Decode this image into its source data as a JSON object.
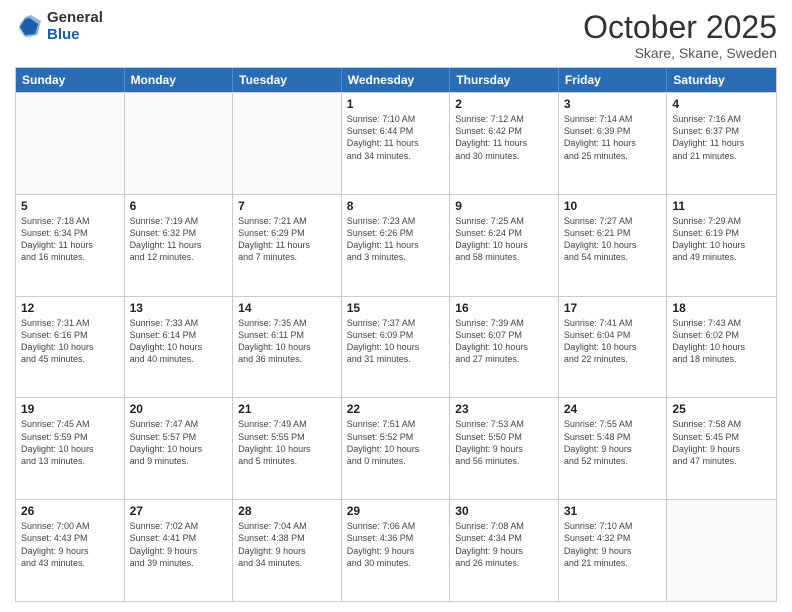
{
  "header": {
    "logo_general": "General",
    "logo_blue": "Blue",
    "month_title": "October 2025",
    "location": "Skare, Skane, Sweden"
  },
  "days_of_week": [
    "Sunday",
    "Monday",
    "Tuesday",
    "Wednesday",
    "Thursday",
    "Friday",
    "Saturday"
  ],
  "weeks": [
    [
      {
        "day": "",
        "text": ""
      },
      {
        "day": "",
        "text": ""
      },
      {
        "day": "",
        "text": ""
      },
      {
        "day": "1",
        "text": "Sunrise: 7:10 AM\nSunset: 6:44 PM\nDaylight: 11 hours\nand 34 minutes."
      },
      {
        "day": "2",
        "text": "Sunrise: 7:12 AM\nSunset: 6:42 PM\nDaylight: 11 hours\nand 30 minutes."
      },
      {
        "day": "3",
        "text": "Sunrise: 7:14 AM\nSunset: 6:39 PM\nDaylight: 11 hours\nand 25 minutes."
      },
      {
        "day": "4",
        "text": "Sunrise: 7:16 AM\nSunset: 6:37 PM\nDaylight: 11 hours\nand 21 minutes."
      }
    ],
    [
      {
        "day": "5",
        "text": "Sunrise: 7:18 AM\nSunset: 6:34 PM\nDaylight: 11 hours\nand 16 minutes."
      },
      {
        "day": "6",
        "text": "Sunrise: 7:19 AM\nSunset: 6:32 PM\nDaylight: 11 hours\nand 12 minutes."
      },
      {
        "day": "7",
        "text": "Sunrise: 7:21 AM\nSunset: 6:29 PM\nDaylight: 11 hours\nand 7 minutes."
      },
      {
        "day": "8",
        "text": "Sunrise: 7:23 AM\nSunset: 6:26 PM\nDaylight: 11 hours\nand 3 minutes."
      },
      {
        "day": "9",
        "text": "Sunrise: 7:25 AM\nSunset: 6:24 PM\nDaylight: 10 hours\nand 58 minutes."
      },
      {
        "day": "10",
        "text": "Sunrise: 7:27 AM\nSunset: 6:21 PM\nDaylight: 10 hours\nand 54 minutes."
      },
      {
        "day": "11",
        "text": "Sunrise: 7:29 AM\nSunset: 6:19 PM\nDaylight: 10 hours\nand 49 minutes."
      }
    ],
    [
      {
        "day": "12",
        "text": "Sunrise: 7:31 AM\nSunset: 6:16 PM\nDaylight: 10 hours\nand 45 minutes."
      },
      {
        "day": "13",
        "text": "Sunrise: 7:33 AM\nSunset: 6:14 PM\nDaylight: 10 hours\nand 40 minutes."
      },
      {
        "day": "14",
        "text": "Sunrise: 7:35 AM\nSunset: 6:11 PM\nDaylight: 10 hours\nand 36 minutes."
      },
      {
        "day": "15",
        "text": "Sunrise: 7:37 AM\nSunset: 6:09 PM\nDaylight: 10 hours\nand 31 minutes."
      },
      {
        "day": "16",
        "text": "Sunrise: 7:39 AM\nSunset: 6:07 PM\nDaylight: 10 hours\nand 27 minutes."
      },
      {
        "day": "17",
        "text": "Sunrise: 7:41 AM\nSunset: 6:04 PM\nDaylight: 10 hours\nand 22 minutes."
      },
      {
        "day": "18",
        "text": "Sunrise: 7:43 AM\nSunset: 6:02 PM\nDaylight: 10 hours\nand 18 minutes."
      }
    ],
    [
      {
        "day": "19",
        "text": "Sunrise: 7:45 AM\nSunset: 5:59 PM\nDaylight: 10 hours\nand 13 minutes."
      },
      {
        "day": "20",
        "text": "Sunrise: 7:47 AM\nSunset: 5:57 PM\nDaylight: 10 hours\nand 9 minutes."
      },
      {
        "day": "21",
        "text": "Sunrise: 7:49 AM\nSunset: 5:55 PM\nDaylight: 10 hours\nand 5 minutes."
      },
      {
        "day": "22",
        "text": "Sunrise: 7:51 AM\nSunset: 5:52 PM\nDaylight: 10 hours\nand 0 minutes."
      },
      {
        "day": "23",
        "text": "Sunrise: 7:53 AM\nSunset: 5:50 PM\nDaylight: 9 hours\nand 56 minutes."
      },
      {
        "day": "24",
        "text": "Sunrise: 7:55 AM\nSunset: 5:48 PM\nDaylight: 9 hours\nand 52 minutes."
      },
      {
        "day": "25",
        "text": "Sunrise: 7:58 AM\nSunset: 5:45 PM\nDaylight: 9 hours\nand 47 minutes."
      }
    ],
    [
      {
        "day": "26",
        "text": "Sunrise: 7:00 AM\nSunset: 4:43 PM\nDaylight: 9 hours\nand 43 minutes."
      },
      {
        "day": "27",
        "text": "Sunrise: 7:02 AM\nSunset: 4:41 PM\nDaylight: 9 hours\nand 39 minutes."
      },
      {
        "day": "28",
        "text": "Sunrise: 7:04 AM\nSunset: 4:38 PM\nDaylight: 9 hours\nand 34 minutes."
      },
      {
        "day": "29",
        "text": "Sunrise: 7:06 AM\nSunset: 4:36 PM\nDaylight: 9 hours\nand 30 minutes."
      },
      {
        "day": "30",
        "text": "Sunrise: 7:08 AM\nSunset: 4:34 PM\nDaylight: 9 hours\nand 26 minutes."
      },
      {
        "day": "31",
        "text": "Sunrise: 7:10 AM\nSunset: 4:32 PM\nDaylight: 9 hours\nand 21 minutes."
      },
      {
        "day": "",
        "text": ""
      }
    ]
  ]
}
